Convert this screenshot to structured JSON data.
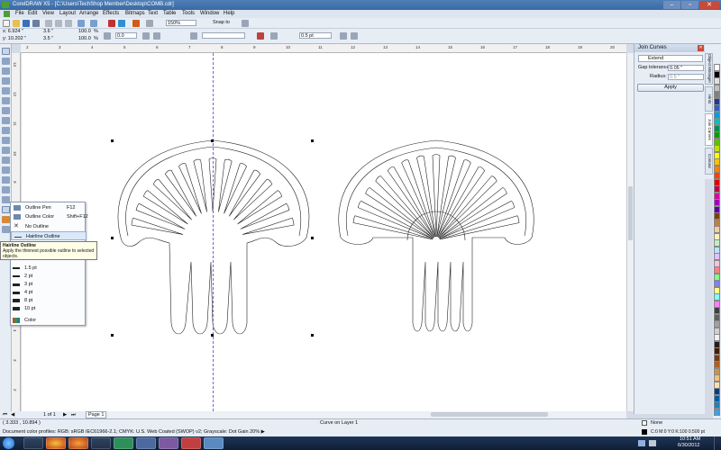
{
  "window": {
    "title": "CorelDRAW X5 - [C:\\Users\\TechShop Member\\Desktop\\COMB.cdr]",
    "minimize": "–",
    "maximize": "▫",
    "close": "✕"
  },
  "menu": [
    "File",
    "Edit",
    "View",
    "Layout",
    "Arrange",
    "Effects",
    "Bitmaps",
    "Text",
    "Table",
    "Tools",
    "Window",
    "Help"
  ],
  "toolbar1": {
    "zoom": "150%",
    "snap_to": "Snap to"
  },
  "propbar": {
    "x": "x: 6.924 \"",
    "y": "y: 10.202 \"",
    "w": "3.6 \"",
    "h": "3.5 \"",
    "scale_w": "100.0",
    "scale_h": "100.0",
    "pct": "%",
    "angle": "0.0",
    "outline_width": "0.5 pt"
  },
  "flyout": {
    "items": [
      {
        "name": "Outline Pen",
        "shortcut": "F12"
      },
      {
        "name": "Outline Color",
        "shortcut": "Shift+F12"
      },
      {
        "name": "No Outline",
        "shortcut": ""
      },
      {
        "name": "Hairline Outline",
        "shortcut": ""
      }
    ],
    "widths": [
      "1.5 pt",
      "2 pt",
      "3 pt",
      "4 pt",
      "8 pt",
      "10 pt"
    ],
    "color_label": "Color"
  },
  "tooltip": {
    "title": "Hairline Outline",
    "desc": "Apply the thinnest possible outline to selected objects."
  },
  "docker": {
    "title": "Join Curves",
    "mode": "Extend",
    "gap_label": "Gap tolerance:",
    "gap_value": "0.05 \"",
    "radius_label": "Radius:",
    "radius_value": "0.5 \"",
    "apply": "Apply"
  },
  "side_tabs": [
    "Object Manager",
    "Hints",
    "Join Curves",
    "Contour"
  ],
  "palette_colors": [
    "#ffffff",
    "#000000",
    "#e0e0e0",
    "#c0c0c0",
    "#808080",
    "#1e3b8c",
    "#2f5fc4",
    "#00a0e0",
    "#00c0c0",
    "#009050",
    "#00a000",
    "#60c000",
    "#c0e000",
    "#ffff00",
    "#ffc000",
    "#ff8000",
    "#ff4000",
    "#e00000",
    "#c00040",
    "#e000a0",
    "#a000c0",
    "#6000a0",
    "#804000",
    "#c08040",
    "#f0d0a0",
    "#fff0c0",
    "#c0f0c0",
    "#c0e0ff",
    "#e0c0ff",
    "#ffc0e0",
    "#ff8080",
    "#80ff80",
    "#8080ff",
    "#ffff80",
    "#80ffff",
    "#ff80ff",
    "#404040",
    "#606060",
    "#a0a0a0",
    "#d0d0d0",
    "#f0f0f0",
    "#202020",
    "#4a1a00",
    "#7a3a10",
    "#b06020",
    "#d09050",
    "#f0c080",
    "#f8e0b0",
    "#004080",
    "#0060a0",
    "#2080c0",
    "#40a0e0"
  ],
  "hruler": [
    "2",
    "3",
    "4",
    "5",
    "6",
    "7",
    "8",
    "9",
    "10",
    "11",
    "12",
    "13",
    "14",
    "15",
    "16",
    "17",
    "18",
    "19",
    "20"
  ],
  "hruler_unit": "inches",
  "vruler": [
    "13",
    "12",
    "11",
    "10",
    "9",
    "8",
    "7",
    "6",
    "5",
    "4",
    "3",
    "2"
  ],
  "pagenav": {
    "counter": "1 of 1",
    "page_tab": "Page 1"
  },
  "status": {
    "coords": "( 3.333 , 10.894 )",
    "object": "Curve on Layer 1",
    "profiles": "Document color profiles: RGB: sRGB IEC61966-2.1; CMYK: U.S. Web Coated (SWOP) v2; Grayscale: Dot Gain 20% ▶",
    "fill": "None",
    "outline": "C:0 M:0 Y:0 K:100  0.500 pt"
  },
  "clock": {
    "time": "10:51 AM",
    "date": "6/30/2012"
  }
}
